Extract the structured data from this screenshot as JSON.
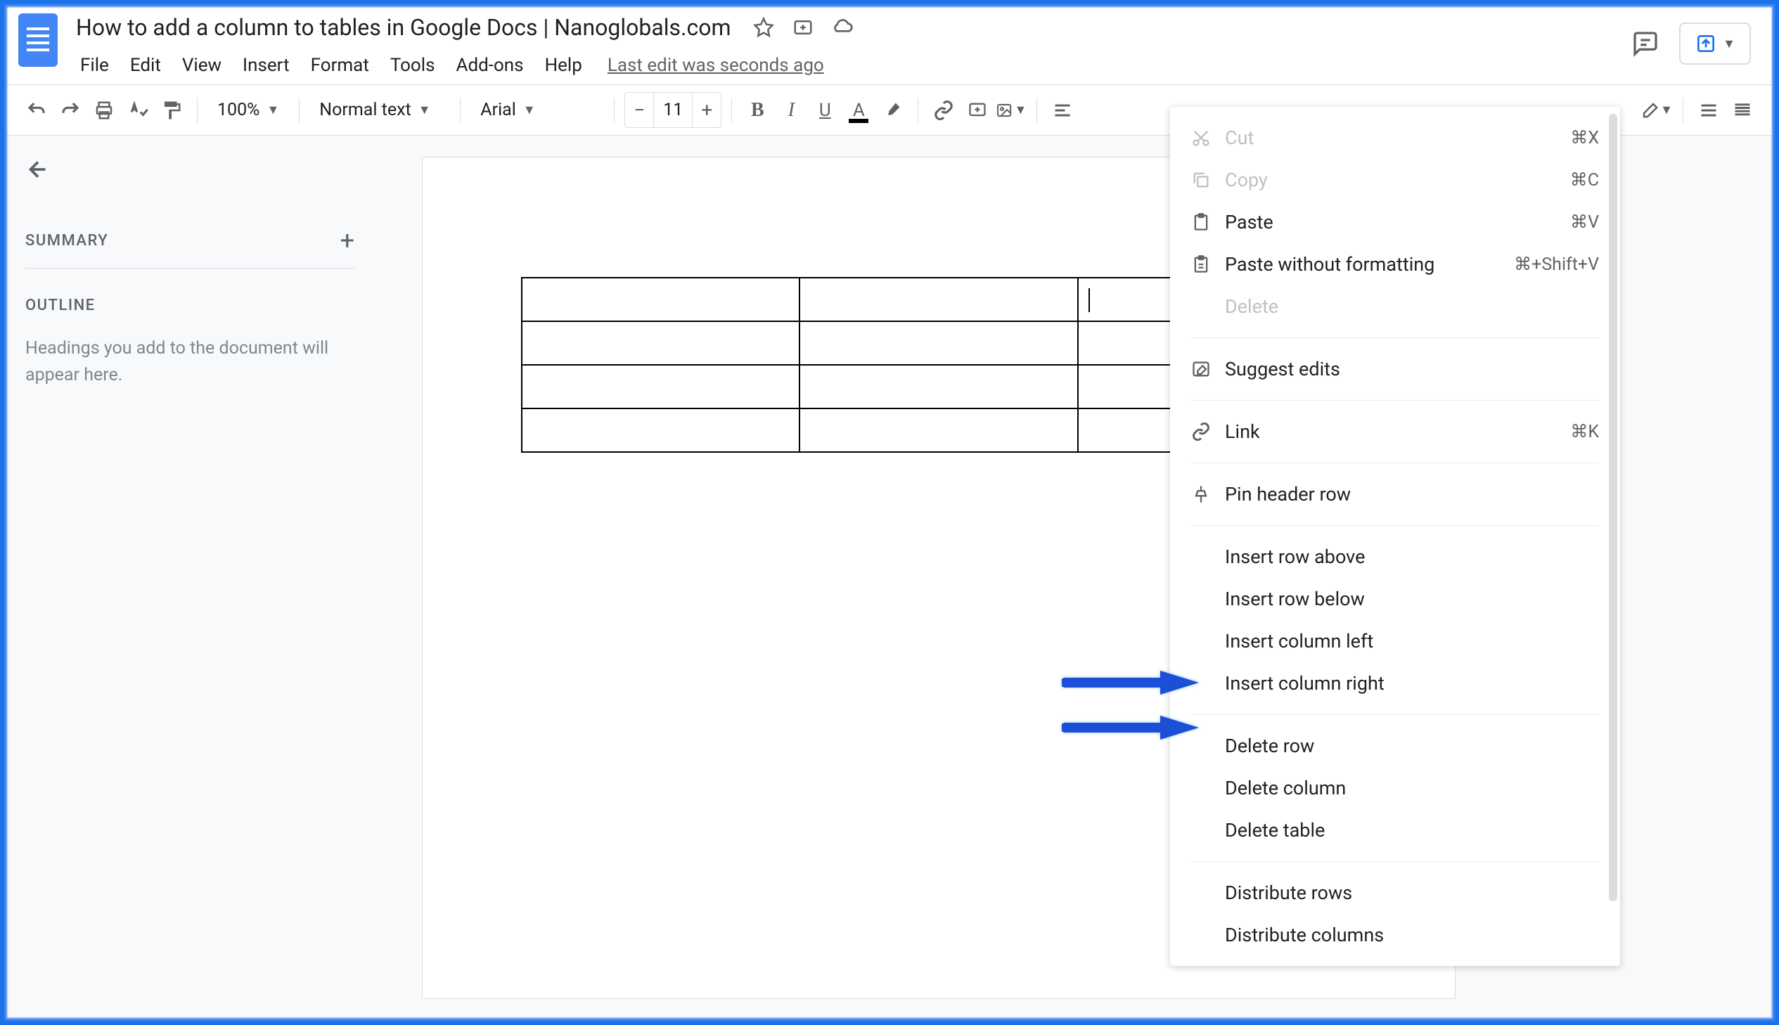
{
  "doc": {
    "title": "How to add a column to tables in Google Docs | Nanoglobals.com",
    "last_edit": "Last edit was seconds ago"
  },
  "menu": {
    "file": "File",
    "edit": "Edit",
    "view": "View",
    "insert": "Insert",
    "format": "Format",
    "tools": "Tools",
    "addons": "Add-ons",
    "help": "Help"
  },
  "toolbar": {
    "zoom": "100%",
    "style": "Normal text",
    "font": "Arial",
    "font_size": "11"
  },
  "sidebar": {
    "summary": "SUMMARY",
    "outline": "OUTLINE",
    "outline_hint": "Headings you add to the document will appear here."
  },
  "context_menu": {
    "cut": "Cut",
    "cut_sc": "⌘X",
    "copy": "Copy",
    "copy_sc": "⌘C",
    "paste": "Paste",
    "paste_sc": "⌘V",
    "paste_wo": "Paste without formatting",
    "paste_wo_sc": "⌘+Shift+V",
    "delete": "Delete",
    "suggest": "Suggest edits",
    "link": "Link",
    "link_sc": "⌘K",
    "pin_header": "Pin header row",
    "insert_row_above": "Insert row above",
    "insert_row_below": "Insert row below",
    "insert_col_left": "Insert column left",
    "insert_col_right": "Insert column right",
    "delete_row": "Delete row",
    "delete_col": "Delete column",
    "delete_table": "Delete table",
    "dist_rows": "Distribute rows",
    "dist_cols": "Distribute columns"
  }
}
